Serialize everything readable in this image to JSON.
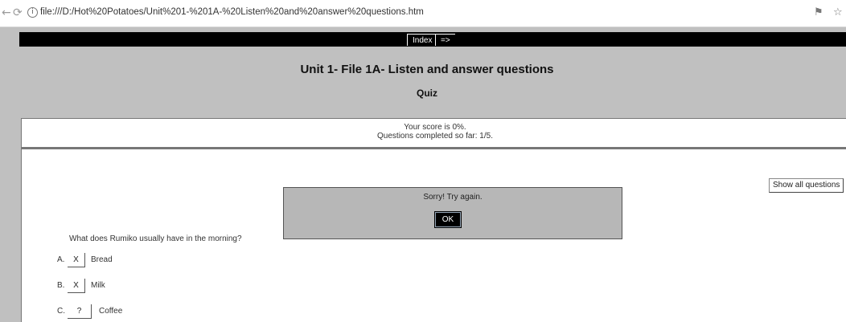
{
  "browser": {
    "back_icon": "←",
    "reload_icon": "⟳",
    "info_icon": "i",
    "url": "file:///D:/Hot%20Potatoes/Unit%201-%201A-%20Listen%20and%20answer%20questions.htm",
    "translate_icon": "⚑",
    "star_icon": "☆"
  },
  "nav": {
    "index_label": "Index",
    "next_label": "=>"
  },
  "page": {
    "title": "Unit 1- File 1A- Listen and answer questions",
    "subtitle": "Quiz"
  },
  "score": {
    "score_text": "Your score is 0%.",
    "progress_text": "Questions completed so far: 1/5."
  },
  "controls": {
    "show_all_label": "Show all questions"
  },
  "feedback": {
    "message": "Sorry! Try again.",
    "ok_label": "OK"
  },
  "quiz": {
    "question": "What does Rumiko usually have in the morning?",
    "answers": [
      {
        "letter": "A.",
        "mark": "X",
        "text": "Bread"
      },
      {
        "letter": "B.",
        "mark": "X",
        "text": "Milk"
      },
      {
        "letter": "C.",
        "mark": "?",
        "text": "Coffee"
      }
    ]
  }
}
